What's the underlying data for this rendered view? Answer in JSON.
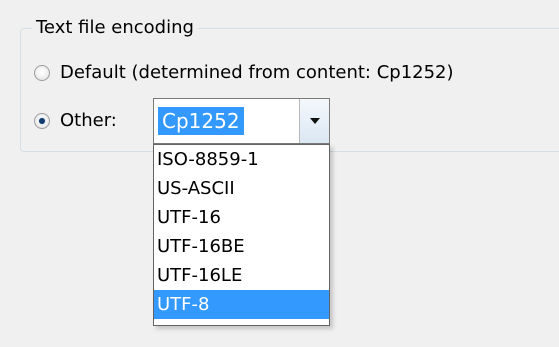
{
  "group": {
    "title": "Text file encoding"
  },
  "options": {
    "default_label": "Default (determined from content: Cp1252)",
    "other_label": "Other:",
    "selected_option": "Other:"
  },
  "combo": {
    "value": "Cp1252",
    "button_icon": "chevron-down-icon"
  },
  "dropdown": {
    "items": [
      {
        "label": "ISO-8859-1",
        "selected": false
      },
      {
        "label": "US-ASCII",
        "selected": false
      },
      {
        "label": "UTF-16",
        "selected": false
      },
      {
        "label": "UTF-16BE",
        "selected": false
      },
      {
        "label": "UTF-16LE",
        "selected": false
      },
      {
        "label": "UTF-8",
        "selected": true
      }
    ]
  },
  "colors": {
    "selection": "#3399ff",
    "window_background": "#f0f0f0"
  }
}
